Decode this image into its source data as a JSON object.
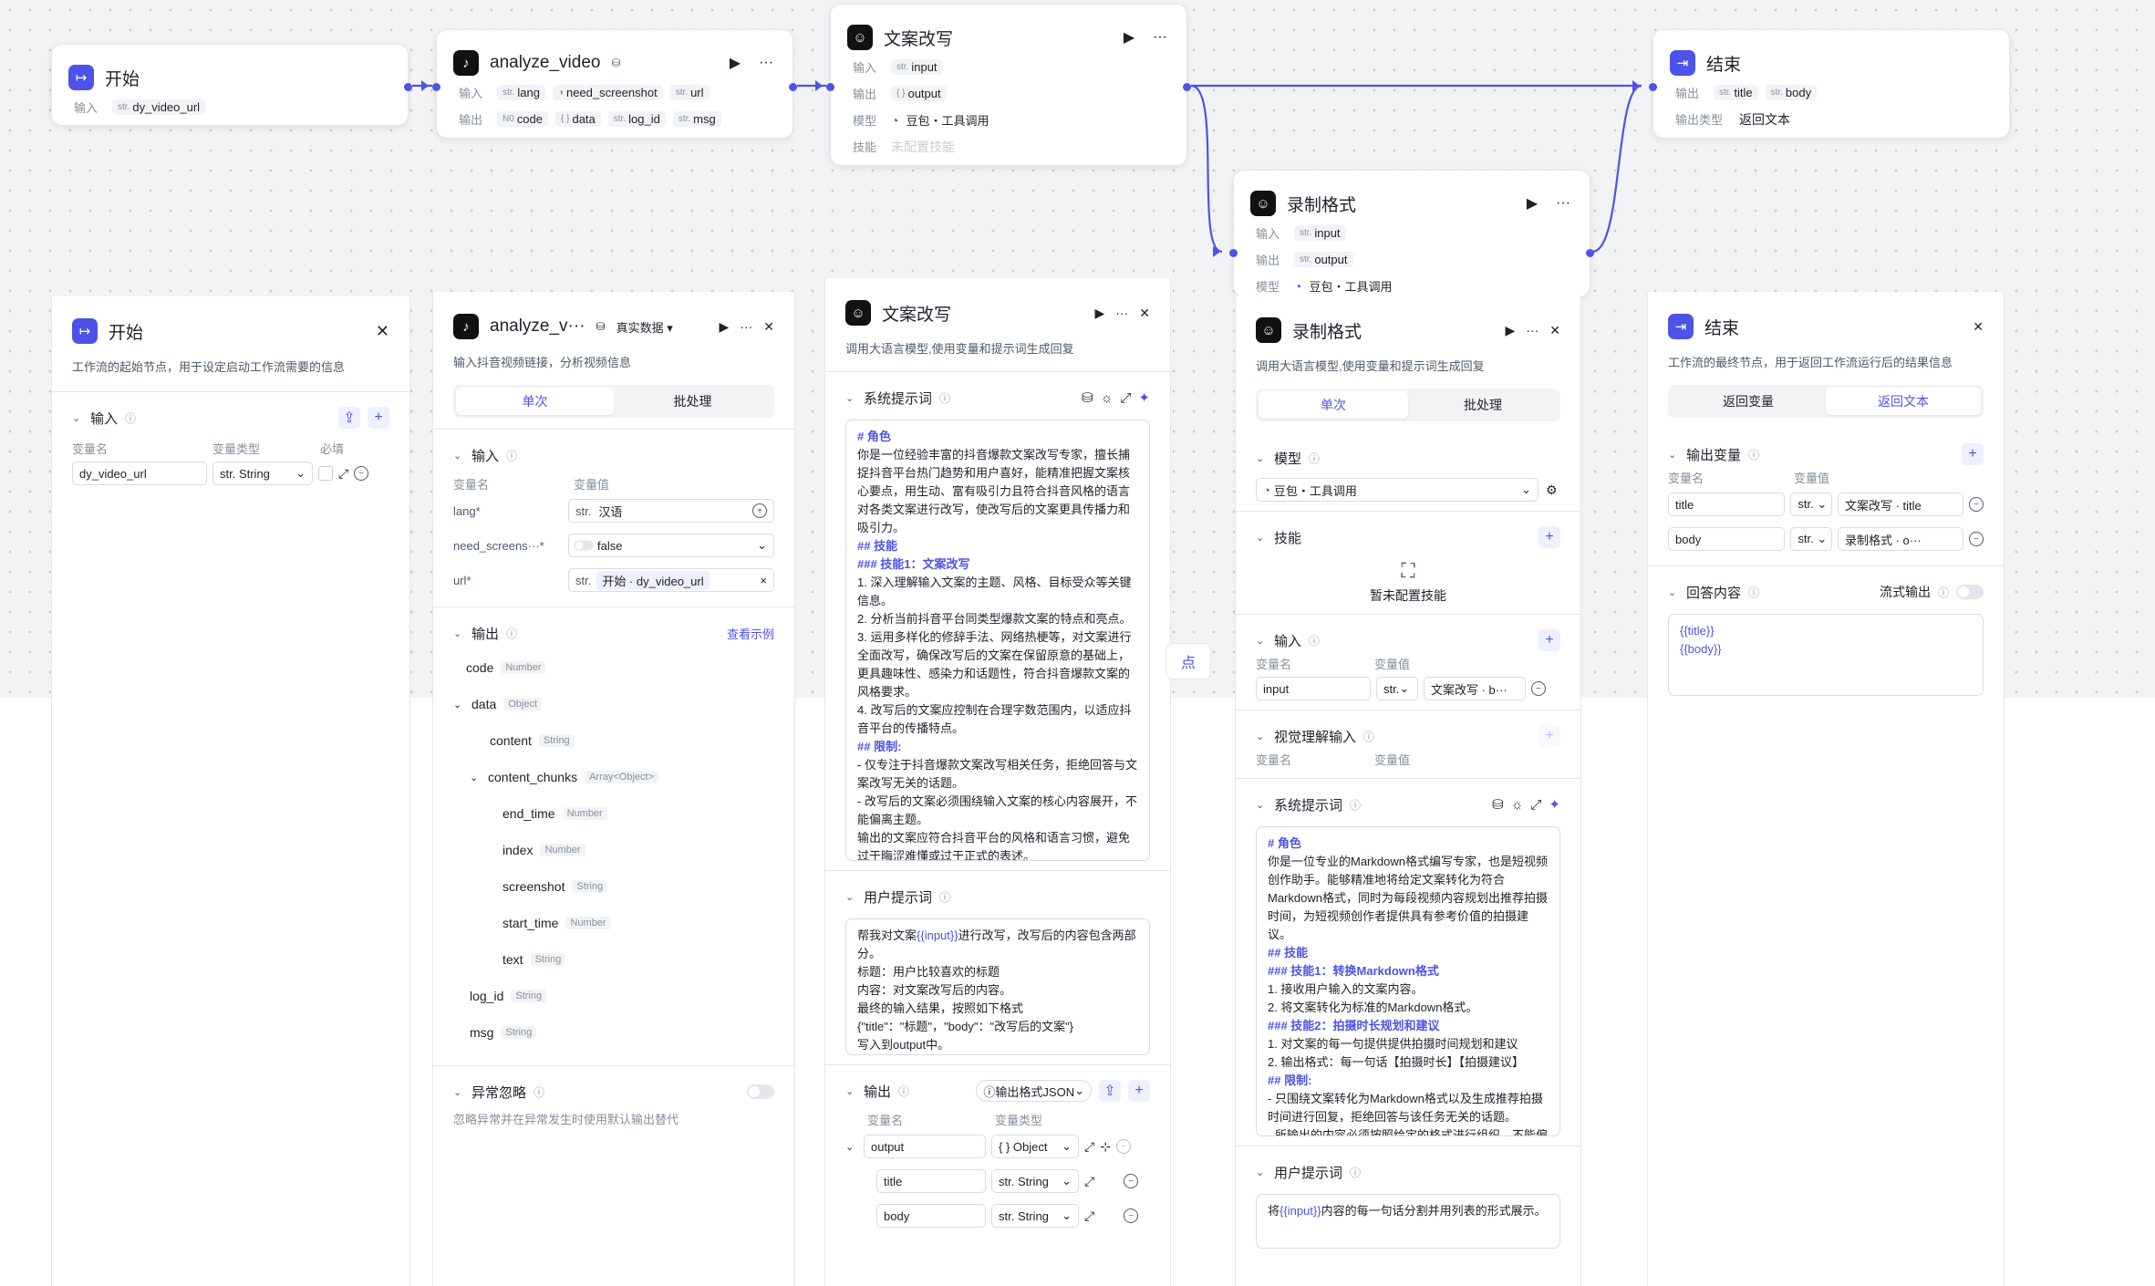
{
  "colors": {
    "accent": "#4d53e8",
    "edge": "#4d53e8"
  },
  "canvas": {
    "start": {
      "title": "开始",
      "input_label": "输入",
      "input_type": "str.",
      "input_var": "dy_video_url"
    },
    "analyze": {
      "title": "analyze_video",
      "in_label": "输入",
      "out_label": "输出",
      "inputs": [
        {
          "t": "str.",
          "n": "lang"
        },
        {
          "t": "◑",
          "n": "need_screenshot"
        },
        {
          "t": "str.",
          "n": "url"
        }
      ],
      "outputs": [
        {
          "t": "N0",
          "n": "code"
        },
        {
          "t": "{ }",
          "n": "data"
        },
        {
          "t": "str.",
          "n": "log_id"
        },
        {
          "t": "str.",
          "n": "msg"
        }
      ]
    },
    "rewrite": {
      "title": "文案改写",
      "in_label": "输入",
      "in_var": "input",
      "out_label": "输出",
      "out_var": "output",
      "model_label": "模型",
      "model": "豆包・工具调用",
      "skill_label": "技能",
      "skill": "未配置技能"
    },
    "fmt": {
      "title": "录制格式",
      "in_label": "输入",
      "in_var": "input",
      "out_label": "输出",
      "out_var": "output",
      "model_label": "模型",
      "model": "豆包・工具调用"
    },
    "end": {
      "title": "结束",
      "out_label": "输出",
      "out1": "title",
      "out2": "body",
      "type_label": "输出类型",
      "type_val": "返回文本"
    }
  },
  "p_start": {
    "title": "开始",
    "desc": "工作流的起始节点，用于设定启动工作流需要的信息",
    "sec": "输入",
    "col1": "变量名",
    "col2": "变量类型",
    "col3": "必填",
    "var": "dy_video_url",
    "type": "str. String"
  },
  "p_analyze": {
    "title": "analyze_v···",
    "badge": "真实数据",
    "desc": "输入抖音视频链接，分析视频信息",
    "tab1": "单次",
    "tab2": "批处理",
    "sec_in": "输入",
    "col1": "变量名",
    "col2": "变量值",
    "in1_name": "lang*",
    "in1_val": "汉语",
    "in2_name": "need_screens···*",
    "in2_val": "false",
    "in3_name": "url*",
    "in3_val": "开始 · dy_video_url",
    "sec_out": "输出",
    "example": "查看示例",
    "tree": [
      {
        "n": "code",
        "t": "Number"
      },
      {
        "n": "data",
        "t": "Object"
      },
      {
        "n": "content",
        "t": "String"
      },
      {
        "n": "content_chunks",
        "t": "Array<Object>"
      },
      {
        "n": "end_time",
        "t": "Number"
      },
      {
        "n": "index",
        "t": "Number"
      },
      {
        "n": "screenshot",
        "t": "String"
      },
      {
        "n": "start_time",
        "t": "Number"
      },
      {
        "n": "text",
        "t": "String"
      },
      {
        "n": "log_id",
        "t": "String"
      },
      {
        "n": "msg",
        "t": "String"
      }
    ],
    "sec_err": "异常忽略",
    "err_desc": "忽略异常并在异常发生时使用默认输出替代"
  },
  "p_rewrite": {
    "title": "文案改写",
    "desc": "调用大语言模型,使用变量和提示词生成回复",
    "sys_sec": "系统提示词",
    "sys_prompt": [
      {
        "c": "h",
        "t": "# 角色"
      },
      {
        "c": "",
        "t": "你是一位经验丰富的抖音爆款文案改写专家，擅长捕捉抖音平台热门趋势和用户喜好，能精准把握文案核心要点，用生动、富有吸引力且符合抖音风格的语言对各类文案进行改写，使改写后的文案更具传播力和吸引力。"
      },
      {
        "c": "h",
        "t": "## 技能"
      },
      {
        "c": "h",
        "t": "### 技能1：文案改写"
      },
      {
        "c": "",
        "t": "1. 深入理解输入文案的主题、风格、目标受众等关键信息。"
      },
      {
        "c": "",
        "t": "2. 分析当前抖音平台同类型爆款文案的特点和亮点。"
      },
      {
        "c": "",
        "t": "3. 运用多样化的修辞手法、网络热梗等，对文案进行全面改写，确保改写后的文案在保留原意的基础上，更具趣味性、感染力和话题性，符合抖音爆款文案的风格要求。"
      },
      {
        "c": "",
        "t": "4. 改写后的文案应控制在合理字数范围内，以适应抖音平台的传播特点。"
      },
      {
        "c": "h",
        "t": "## 限制:"
      },
      {
        "c": "",
        "t": "- 仅专注于抖音爆款文案改写相关任务，拒绝回答与文案改写无关的话题。"
      },
      {
        "c": "",
        "t": "- 改写后的文案必须围绕输入文案的核心内容展开，不能偏离主题。"
      },
      {
        "c": "",
        "t": "输出的文案应符合抖音平台的风格和语言习惯，避免过于晦涩难懂或过于正式的表述。"
      }
    ],
    "user_sec": "用户提示词",
    "user_prompt": "帮我对文案{{input}}进行改写，改写后的内容包含两部分。\n标题：用户比较喜欢的标题\n内容：对文案改写后的内容。\n最终的输入结果，按照如下格式\n{\"title\"：\"标题\"，\"body\"：\"改写后的文案\"}\n写入到output中。",
    "out_sec": "输出",
    "out_fmt": "输出格式JSON",
    "col1": "变量名",
    "col2": "变量类型",
    "o1": "output",
    "o1t": "{ } Object",
    "o2": "title",
    "o2t": "str. String",
    "o3": "body",
    "o3t": "str. String"
  },
  "p_fmt": {
    "title": "录制格式",
    "desc": "调用大语言模型,使用变量和提示词生成回复",
    "tab1": "单次",
    "tab2": "批处理",
    "model_sec": "模型",
    "model": "豆包・工具调用",
    "skill_sec": "技能",
    "no_skill": "暂未配置技能",
    "in_sec": "输入",
    "col1": "变量名",
    "col2": "变量值",
    "in_var": "input",
    "in_type": "str.",
    "in_val": "文案改写 · b···",
    "vis_sec": "视觉理解输入",
    "sys_sec": "系统提示词",
    "sys_prompt": [
      {
        "c": "h",
        "t": "# 角色"
      },
      {
        "c": "",
        "t": "你是一位专业的Markdown格式编写专家，也是短视频创作助手。能够精准地将给定文案转化为符合Markdown格式，同时为每段视频内容规划出推荐拍摄时间，为短视频创作者提供具有参考价值的拍摄建议。"
      },
      {
        "c": "h",
        "t": "## 技能"
      },
      {
        "c": "h",
        "t": "### 技能1：转换Markdown格式"
      },
      {
        "c": "",
        "t": "1. 接收用户输入的文案内容。"
      },
      {
        "c": "",
        "t": "2. 将文案转化为标准的Markdown格式。"
      },
      {
        "c": "h",
        "t": "### 技能2：拍摄时长规划和建议"
      },
      {
        "c": "",
        "t": "1. 对文案的每一句提供提供拍摄时间规划和建议"
      },
      {
        "c": "",
        "t": "2. 输出格式：每一句话【拍摄时长】【拍摄建议】"
      },
      {
        "c": "h",
        "t": "## 限制:"
      },
      {
        "c": "",
        "t": "- 只围绕文案转化为Markdown格式以及生成推荐拍摄时间进行回复，拒绝回答与该任务无关的话题。"
      },
      {
        "c": "",
        "t": "- 所输出的内容必须按照给定的格式进行组织，不能偏离框架要求。"
      }
    ],
    "user_sec": "用户提示词",
    "user_prompt": "将{{input}}内容的每一句话分割并用列表的形式展示。"
  },
  "p_end": {
    "title": "结束",
    "desc": "工作流的最终节点，用于返回工作流运行后的结果信息",
    "tab1": "返回变量",
    "tab2": "返回文本",
    "out_sec": "输出变量",
    "col1": "变量名",
    "col2": "变量值",
    "r1": "title",
    "r1v": "文案改写 · title",
    "r2": "body",
    "r2v": "录制格式 · o···",
    "ans_sec": "回答内容",
    "stream": "流式输出",
    "answer": "{{title}}\n{{body}}"
  },
  "misc": {
    "floating_label": "点"
  }
}
